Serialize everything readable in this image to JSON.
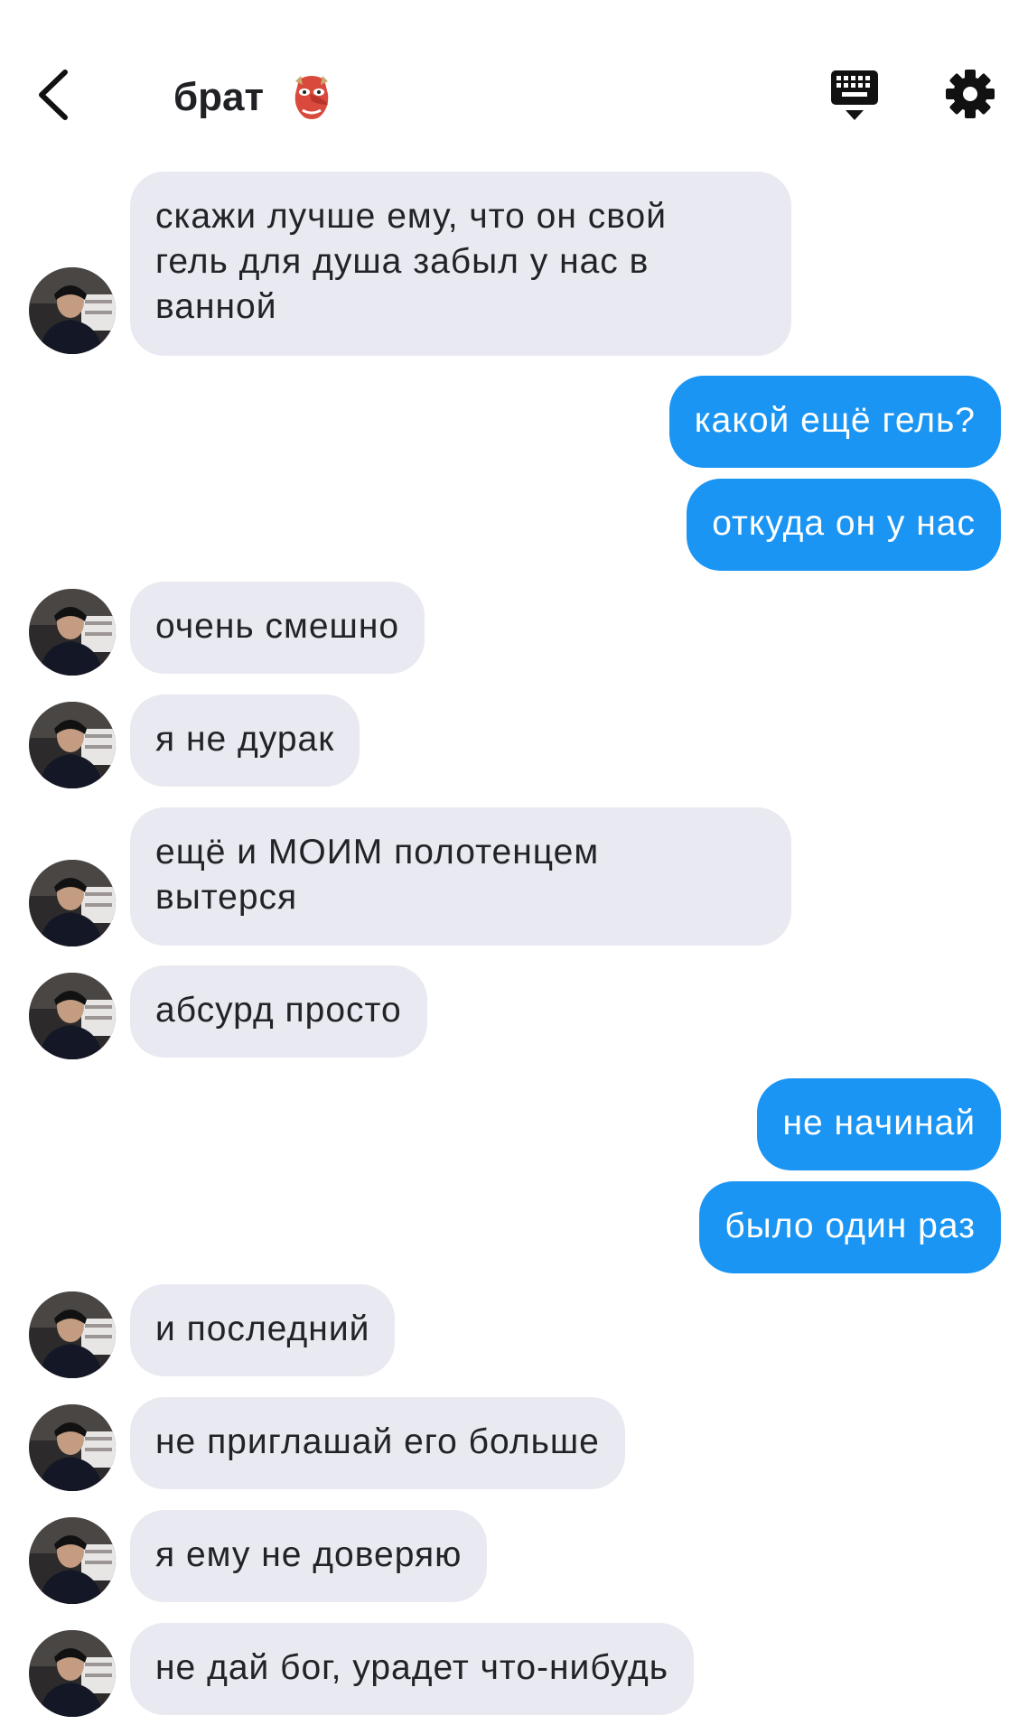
{
  "header": {
    "title": "брат",
    "back_icon": "chevron-left-icon",
    "title_emoji_icon": "goblin-mask-icon",
    "keyboard_icon": "keyboard-hide-icon",
    "settings_icon": "gear-icon"
  },
  "colors": {
    "incoming_bubble": "#e9eaf1",
    "outgoing_bubble": "#1b95f3",
    "text_dark": "#222327",
    "icon": "#111111"
  },
  "messages": [
    {
      "direction": "in",
      "text": "скажи лучше ему, что он свой\nгель для душа забыл у нас в\nванной"
    },
    {
      "direction": "out",
      "text": "какой ещё гель?"
    },
    {
      "direction": "out",
      "text": "откуда он у нас"
    },
    {
      "direction": "in",
      "text": "очень смешно"
    },
    {
      "direction": "in",
      "text": "я не дурак"
    },
    {
      "direction": "in",
      "text": "ещё и МОИМ полотенцем\nвытерся"
    },
    {
      "direction": "in",
      "text": "абсурд просто"
    },
    {
      "direction": "out",
      "text": "не начинай"
    },
    {
      "direction": "out",
      "text": "было один раз"
    },
    {
      "direction": "in",
      "text": "и последний"
    },
    {
      "direction": "in",
      "text": "не приглашай его больше"
    },
    {
      "direction": "in",
      "text": "я ему не доверяю"
    },
    {
      "direction": "in",
      "text": "не дай бог, урадет что-нибудь"
    }
  ]
}
